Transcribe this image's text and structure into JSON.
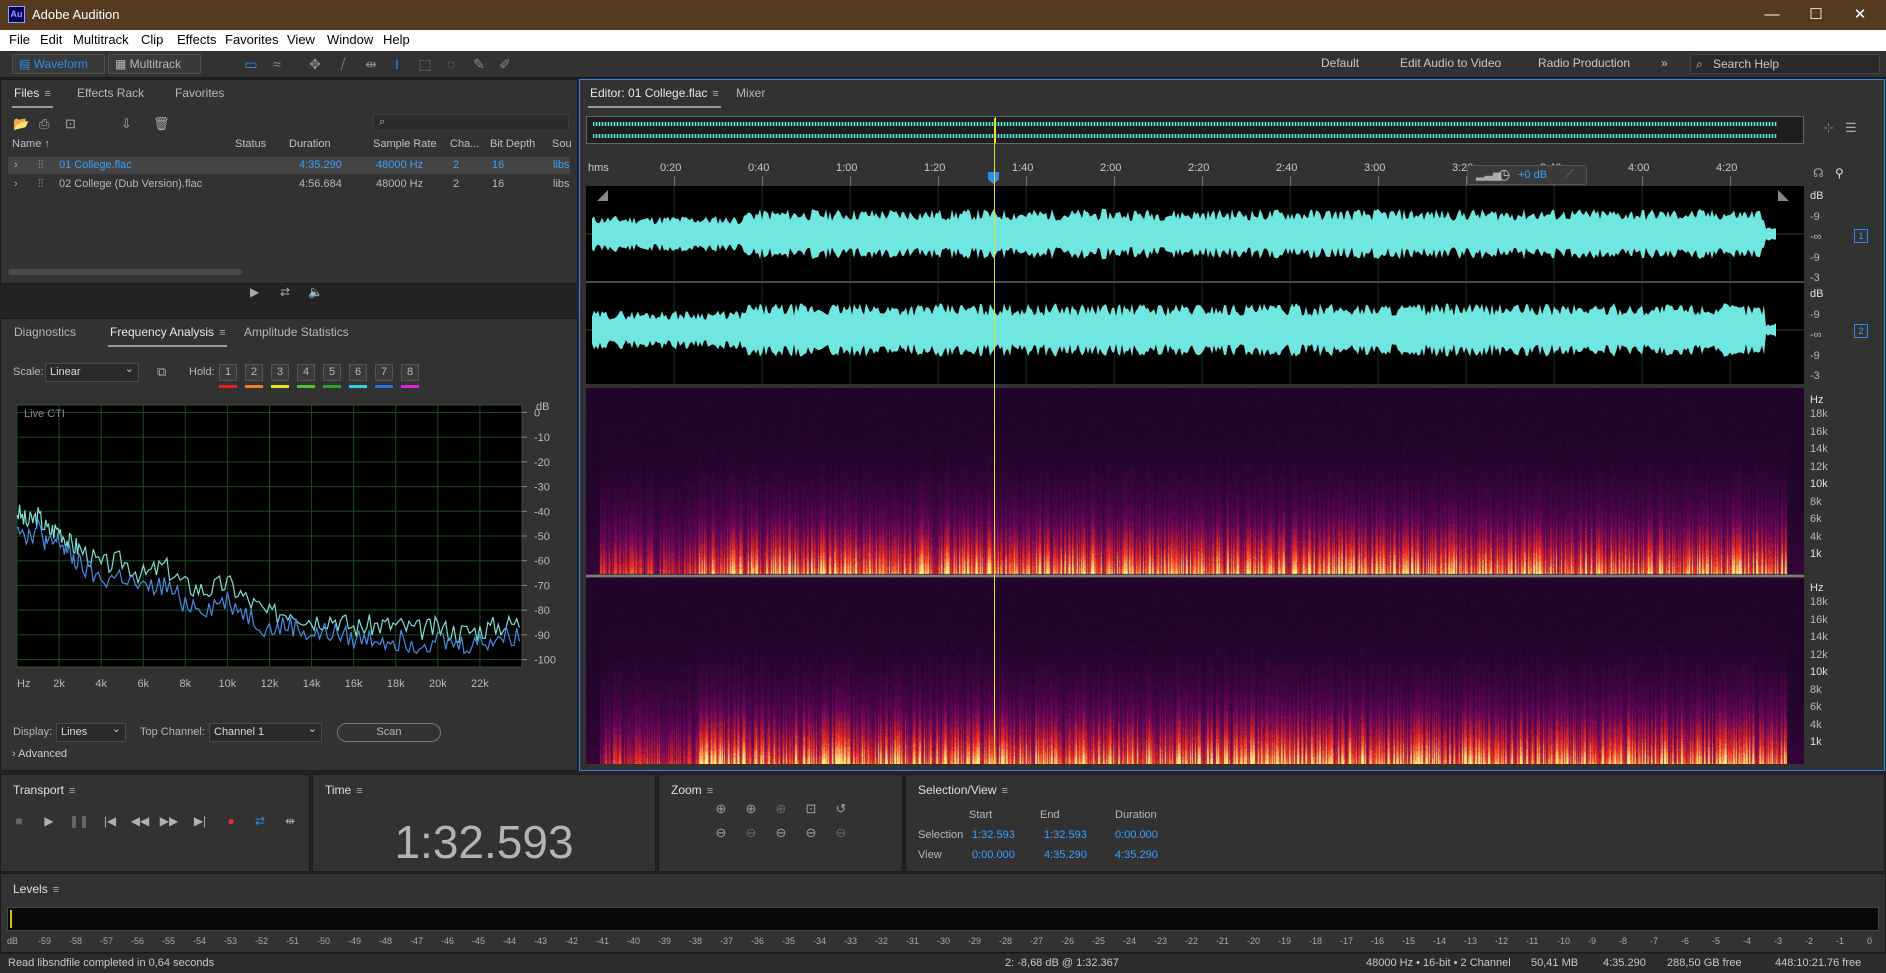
{
  "window": {
    "title": "Adobe Audition",
    "logo": "Au"
  },
  "menu": [
    "File",
    "Edit",
    "Multitrack",
    "Clip",
    "Effects",
    "Favorites",
    "View",
    "Window",
    "Help"
  ],
  "toolbar": {
    "waveform_label": "Waveform",
    "multitrack_label": "Multitrack",
    "workspaces": [
      "Default",
      "Edit Audio to Video",
      "Radio Production"
    ],
    "search_placeholder": "Search Help"
  },
  "files_panel": {
    "tabs": [
      "Files",
      "Effects Rack",
      "Favorites"
    ],
    "columns": [
      "Name",
      "Status",
      "Duration",
      "Sample Rate",
      "Cha...",
      "Bit Depth",
      "Sou"
    ],
    "rows": [
      {
        "name": "01 College.flac",
        "status": "",
        "duration": "4:35.290",
        "sample_rate": "48000 Hz",
        "channels": "2",
        "bit_depth": "16",
        "source": "libs"
      },
      {
        "name": "02 College (Dub Version).flac",
        "status": "",
        "duration": "4:56.684",
        "sample_rate": "48000 Hz",
        "channels": "2",
        "bit_depth": "16",
        "source": "libs"
      }
    ]
  },
  "analysis_panel": {
    "tabs": [
      "Diagnostics",
      "Frequency Analysis",
      "Amplitude Statistics"
    ],
    "scale_label": "Scale:",
    "scale_value": "Linear",
    "hold_label": "Hold:",
    "hold_buttons": [
      "1",
      "2",
      "3",
      "4",
      "5",
      "6",
      "7",
      "8"
    ],
    "hold_colors": [
      "#e02020",
      "#f08020",
      "#e8e020",
      "#50c030",
      "#30a030",
      "#30d0e0",
      "#3070e0",
      "#e020e0"
    ],
    "graph_label": "Live CTI",
    "db_unit": "dB",
    "display_label": "Display:",
    "display_value": "Lines",
    "top_channel_label": "Top Channel:",
    "top_channel_value": "Channel 1",
    "scan_label": "Scan",
    "advanced_label": "Advanced"
  },
  "chart_data": {
    "type": "line",
    "title": "",
    "xlabel": "Hz",
    "ylabel": "dB",
    "x_ticks": [
      "Hz",
      "2k",
      "4k",
      "6k",
      "8k",
      "10k",
      "12k",
      "14k",
      "16k",
      "18k",
      "20k",
      "22k"
    ],
    "y_ticks": [
      "0",
      "-10",
      "-20",
      "-30",
      "-40",
      "-50",
      "-60",
      "-70",
      "-80",
      "-90",
      "-100"
    ],
    "xlim": [
      0,
      24000
    ],
    "ylim": [
      -103,
      3
    ],
    "grid": true,
    "series": [
      {
        "color": "#7fe0d0",
        "x": [
          0,
          500,
          1000,
          1500,
          2000,
          2500,
          3000,
          4000,
          5000,
          6000,
          7000,
          8000,
          9000,
          10000,
          11000,
          12000,
          13000,
          14000,
          15000,
          16000,
          17000,
          18000,
          19000,
          20000,
          21000,
          22000,
          23000,
          24000
        ],
        "y": [
          -40,
          -45,
          -42,
          -48,
          -47,
          -53,
          -55,
          -62,
          -60,
          -66,
          -62,
          -70,
          -72,
          -69,
          -76,
          -82,
          -80,
          -84,
          -83,
          -87,
          -86,
          -86,
          -88,
          -87,
          -89,
          -88,
          -86,
          -85
        ]
      },
      {
        "color": "#4a8ae0",
        "x": [
          0,
          500,
          1000,
          1500,
          2000,
          2500,
          3000,
          4000,
          5000,
          6000,
          7000,
          8000,
          9000,
          10000,
          11000,
          12000,
          13000,
          14000,
          15000,
          16000,
          17000,
          18000,
          19000,
          20000,
          21000,
          22000,
          23000,
          24000
        ],
        "y": [
          -44,
          -50,
          -47,
          -54,
          -52,
          -58,
          -62,
          -68,
          -66,
          -72,
          -70,
          -77,
          -79,
          -76,
          -82,
          -88,
          -86,
          -90,
          -89,
          -92,
          -91,
          -92,
          -93,
          -92,
          -94,
          -93,
          -91,
          -90
        ]
      }
    ]
  },
  "editor": {
    "tabs": [
      "Editor: 01 College.flac",
      "Mixer"
    ],
    "ruler_labels": [
      "hms",
      "0:20",
      "0:40",
      "1:00",
      "1:20",
      "1:40",
      "2:00",
      "2:20",
      "2:40",
      "3:00",
      "3:20",
      "3:40",
      "4:00",
      "4:20"
    ],
    "gain": "+0 dB",
    "db_labels": [
      "dB",
      "-9",
      "-∞",
      "-9",
      "-3"
    ],
    "channel_badges": [
      "1",
      "2"
    ],
    "hz_labels": [
      "Hz",
      "18k",
      "16k",
      "14k",
      "12k",
      "10k",
      "8k",
      "6k",
      "4k",
      "1k"
    ]
  },
  "transport": {
    "title": "Transport"
  },
  "time_panel": {
    "title": "Time",
    "value": "1:32.593"
  },
  "zoom_panel": {
    "title": "Zoom"
  },
  "selection_view": {
    "title": "Selection/View",
    "headers": [
      "Start",
      "End",
      "Duration"
    ],
    "selection_label": "Selection",
    "selection": [
      "1:32.593",
      "1:32.593",
      "0:00.000"
    ],
    "view_label": "View",
    "view": [
      "0:00.000",
      "4:35.290",
      "4:35.290"
    ]
  },
  "levels": {
    "title": "Levels",
    "ticks": [
      "dB",
      "-59",
      "-58",
      "-57",
      "-56",
      "-55",
      "-54",
      "-53",
      "-52",
      "-51",
      "-50",
      "-49",
      "-48",
      "-47",
      "-46",
      "-45",
      "-44",
      "-43",
      "-42",
      "-41",
      "-40",
      "-39",
      "-38",
      "-37",
      "-36",
      "-35",
      "-34",
      "-33",
      "-32",
      "-31",
      "-30",
      "-29",
      "-28",
      "-27",
      "-26",
      "-25",
      "-24",
      "-23",
      "-22",
      "-21",
      "-20",
      "-19",
      "-18",
      "-17",
      "-16",
      "-15",
      "-14",
      "-13",
      "-12",
      "-11",
      "-10",
      "-9",
      "-8",
      "-7",
      "-6",
      "-5",
      "-4",
      "-3",
      "-2",
      "-1",
      "0"
    ]
  },
  "status": {
    "message": "Read libsndfile completed in 0,64 seconds",
    "cursor": "2: -8,68 dB @ 1:32.367",
    "format": "48000 Hz • 16-bit • 2 Channel",
    "size": "50,41 MB",
    "duration": "4:35.290",
    "free_space": "288,50 GB free",
    "free_time": "448:10:21.76 free"
  },
  "colors": {
    "accent": "#2d8ceb",
    "waveform": "#6fe6e0",
    "playhead": "#e8e030"
  }
}
